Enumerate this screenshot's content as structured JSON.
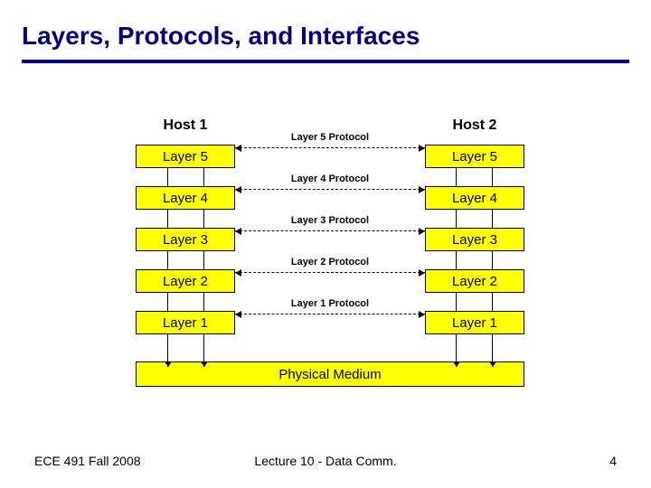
{
  "title": "Layers, Protocols, and Interfaces",
  "hosts": {
    "left": "Host 1",
    "right": "Host 2"
  },
  "rows": [
    {
      "layer": "Layer 5",
      "protocol": "Layer 5 Protocol"
    },
    {
      "layer": "Layer 4",
      "protocol": "Layer 4 Protocol"
    },
    {
      "layer": "Layer 3",
      "protocol": "Layer 3 Protocol"
    },
    {
      "layer": "Layer 2",
      "protocol": "Layer 2 Protocol"
    },
    {
      "layer": "Layer 1",
      "protocol": "Layer 1 Protocol"
    }
  ],
  "physical": "Physical Medium",
  "footer": {
    "left": "ECE 491 Fall 2008",
    "center": "Lecture 10 - Data Comm.",
    "right": "4"
  }
}
